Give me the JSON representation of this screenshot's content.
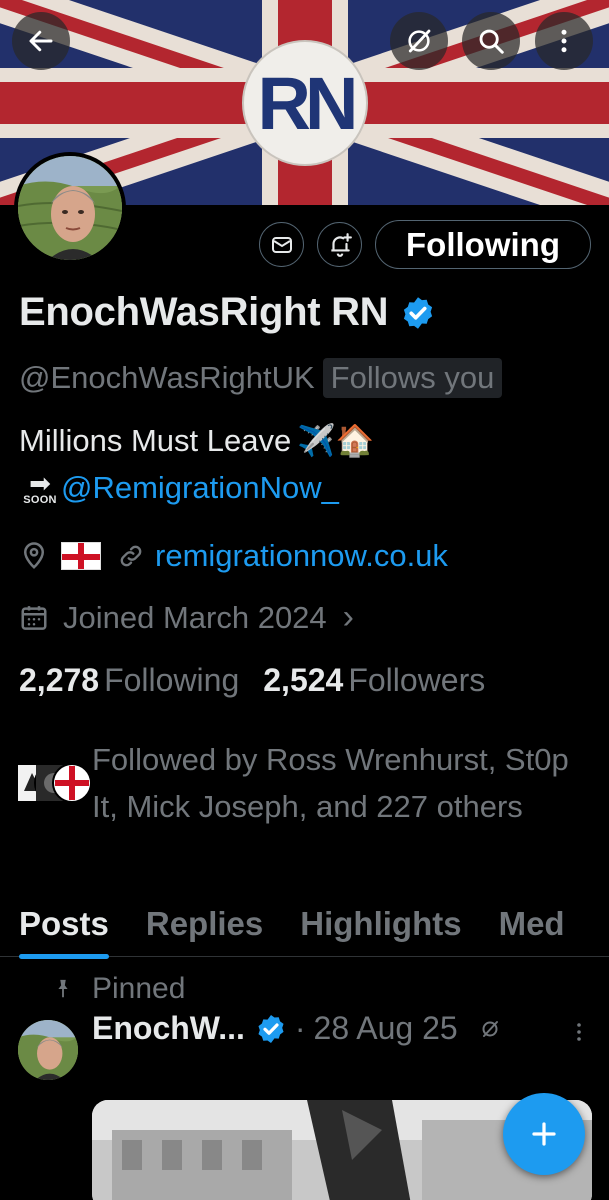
{
  "header": {
    "back_icon": "arrow-left-icon",
    "grok_icon": "grok-icon",
    "search_icon": "search-icon",
    "more_icon": "more-vertical-icon",
    "banner_logo_text": "RN"
  },
  "profile": {
    "display_name": "EnochWasRight RN",
    "handle": "@EnochWasRightUK",
    "follows_you": "Follows you",
    "bio_line1": "Millions Must Leave",
    "bio_emojis": "✈️🏠",
    "bio_arrow": "➡",
    "bio_soon": "SOON",
    "bio_mention": "@RemigrationNow_",
    "location_flag": "🏴󠁧󠁢󠁥󠁮󠁧󠁿",
    "website": "remigrationnow.co.uk",
    "joined": "Joined March 2024",
    "joined_chevron": "›",
    "following_count": "2,278",
    "following_label": "Following",
    "followers_count": "2,524",
    "followers_label": "Followers",
    "followed_by": "Followed by Ross Wrenhurst, St0p It, Mick Joseph, and 227 others"
  },
  "actions": {
    "following_button": "Following"
  },
  "tabs": [
    {
      "label": "Posts",
      "active": true
    },
    {
      "label": "Replies",
      "active": false
    },
    {
      "label": "Highlights",
      "active": false
    },
    {
      "label": "Med",
      "active": false
    }
  ],
  "post": {
    "pinned_label": "Pinned",
    "author": "EnochW...",
    "separator": "·",
    "date": "28 Aug 25"
  },
  "colors": {
    "accent": "#1d9bf0",
    "muted": "#71767b",
    "background": "#000000",
    "border": "#2f3336"
  }
}
